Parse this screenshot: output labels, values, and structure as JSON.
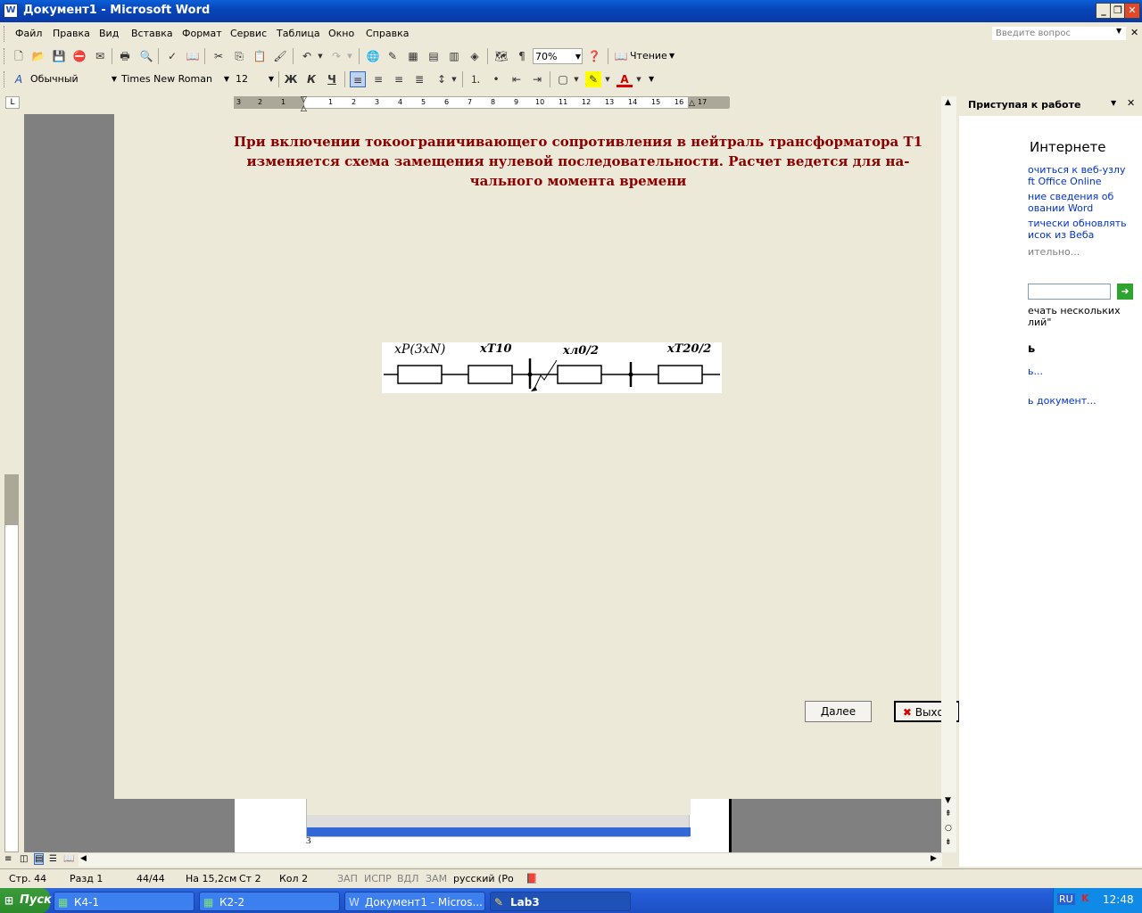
{
  "window": {
    "title": "Документ1 - Microsoft Word",
    "app_icon": "W",
    "buttons": [
      "_",
      "❐",
      "✕"
    ]
  },
  "menu": {
    "items": [
      "Файл",
      "Правка",
      "Вид",
      "Вставка",
      "Формат",
      "Сервис",
      "Таблица",
      "Окно",
      "Справка"
    ],
    "ask_placeholder": "Введите вопрос"
  },
  "toolbar_standard": {
    "zoom": "70%",
    "reading": "Чтение"
  },
  "toolbar_format": {
    "style": "Обычный",
    "font": "Times New Roman",
    "size": "12",
    "bold": "Ж",
    "italic": "К",
    "underline": "Ч"
  },
  "ruler": {
    "left_nums": [
      "3",
      "2",
      "1"
    ],
    "right_nums": [
      "1",
      "2",
      "3",
      "4",
      "5",
      "6",
      "7",
      "8",
      "9",
      "10",
      "11",
      "12",
      "13",
      "14",
      "15",
      "16",
      "17"
    ]
  },
  "dialog": {
    "heading_line1": "При включении токоограничивающего сопротивления в нейтраль трансформатора Т1",
    "heading_line2": "изменяется схема замещения нулевой последовательности. Расчет ведется для на-",
    "heading_line3": "чального момента времени",
    "next_button": "Далее",
    "exit_button": "Выход"
  },
  "diagram": {
    "label1": "xP(3xN)",
    "label2": "xT10",
    "label3": "xл0/2",
    "label4": "xT20/2"
  },
  "taskpane": {
    "title": "Приступая к работе",
    "section1": "Интернете",
    "links": [
      "очиться к веб-узлу",
      "ft Office Online",
      "ние сведения об",
      "овании Word",
      "тически обновлять",
      "исок из Веба"
    ],
    "more": "ительно...",
    "hint1": "ечать нескольких",
    "hint2": "лий\"",
    "section2": "ь",
    "link2": "ь...",
    "link3": "ь документ..."
  },
  "page_number": "3",
  "status": {
    "page": "Стр. 44",
    "section": "Разд 1",
    "pages": "44/44",
    "at": "На 15,2см",
    "line": "Ст 2",
    "col": "Кол 2",
    "rec": "ЗАП",
    "trk": "ИСПР",
    "ext": "ВДЛ",
    "ovr": "ЗАМ",
    "lang": "русский (Ро"
  },
  "taskbar": {
    "start": "Пуск",
    "tasks": [
      "К4-1",
      "К2-2",
      "Документ1 - Micros...",
      "Lab3"
    ],
    "lang": "RU",
    "time": "12:48"
  },
  "colors": {
    "heading": "#8b0000",
    "xp_blue": "#0a5fd8",
    "dialog_bg": "#ece9d8"
  }
}
